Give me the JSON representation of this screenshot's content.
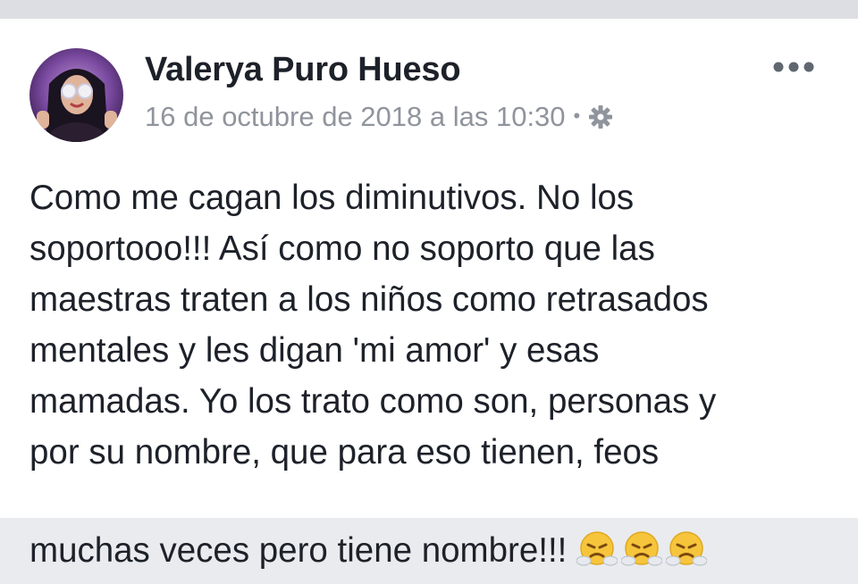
{
  "post": {
    "author": "Valerya Puro Hueso",
    "timestamp": "16 de octubre de 2018 a las 10:30",
    "separator": "•",
    "privacy_icon": "gear-icon",
    "menu_icon": "more-horizontal-icon",
    "body_text": "Como me cagan los diminutivos. No los\nsoportooo!!! Así como no soporto que las\nmaestras traten a los niños como retrasados\nmentales y les digan 'mi amor' y esas\nmamadas. Yo los trato como son, personas y\npor su nombre, que para eso tienen, feos\nmuchas veces pero tiene nombre!!! ",
    "emojis": [
      "face-with-steam-from-nose",
      "face-with-steam-from-nose",
      "face-with-steam-from-nose"
    ]
  },
  "colors": {
    "background": "#ffffff",
    "text": "#1d2129",
    "meta_text": "#90949c",
    "emoji_yellow": "#f7c53c"
  }
}
